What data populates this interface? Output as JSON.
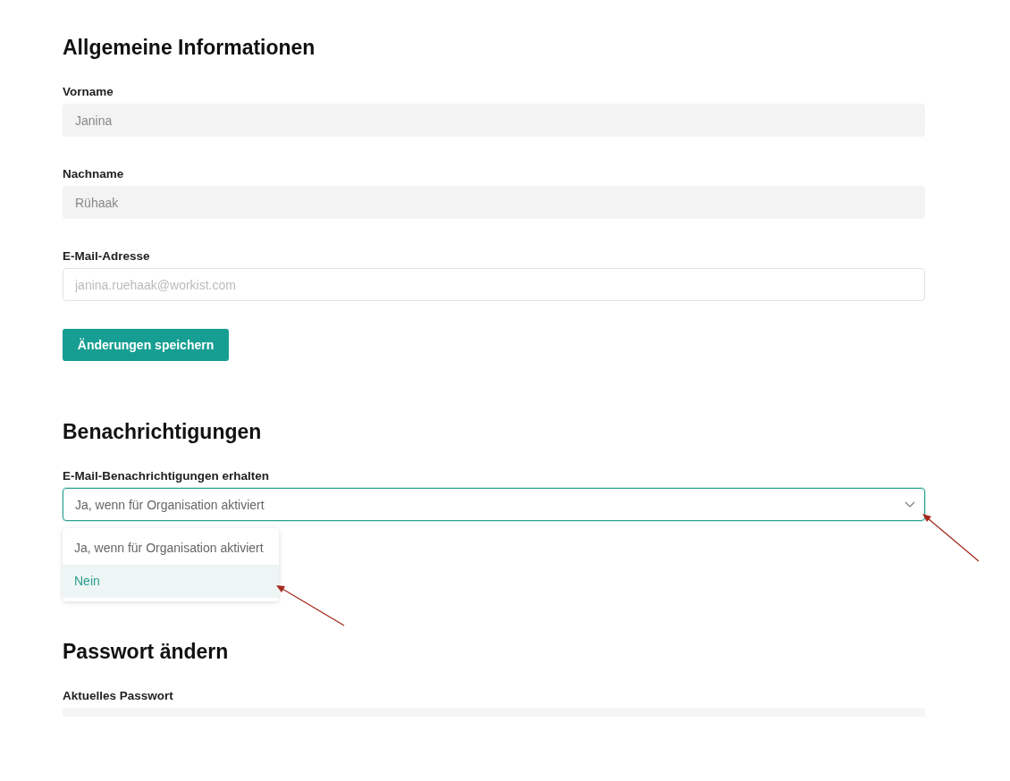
{
  "general": {
    "title": "Allgemeine Informationen",
    "fields": [
      {
        "label": "Vorname",
        "value": "Janina",
        "disabled": true
      },
      {
        "label": "Nachname",
        "value": "Rühaak",
        "disabled": true
      },
      {
        "label": "E-Mail-Adresse",
        "placeholder": "janina.ruehaak@workist.com",
        "disabled": false
      }
    ],
    "save_button": "Änderungen speichern"
  },
  "notifications": {
    "title": "Benachrichtigungen",
    "label": "E-Mail-Benachrichtigungen erhalten",
    "value": "Ja, wenn für Organisation aktiviert",
    "expanded": true,
    "options": [
      {
        "label": "Ja, wenn für Organisation aktiviert",
        "highlighted": false
      },
      {
        "label": "Nein",
        "highlighted": true
      }
    ]
  },
  "password": {
    "title": "Passwort ändern",
    "label": "Aktuelles Passwort"
  }
}
